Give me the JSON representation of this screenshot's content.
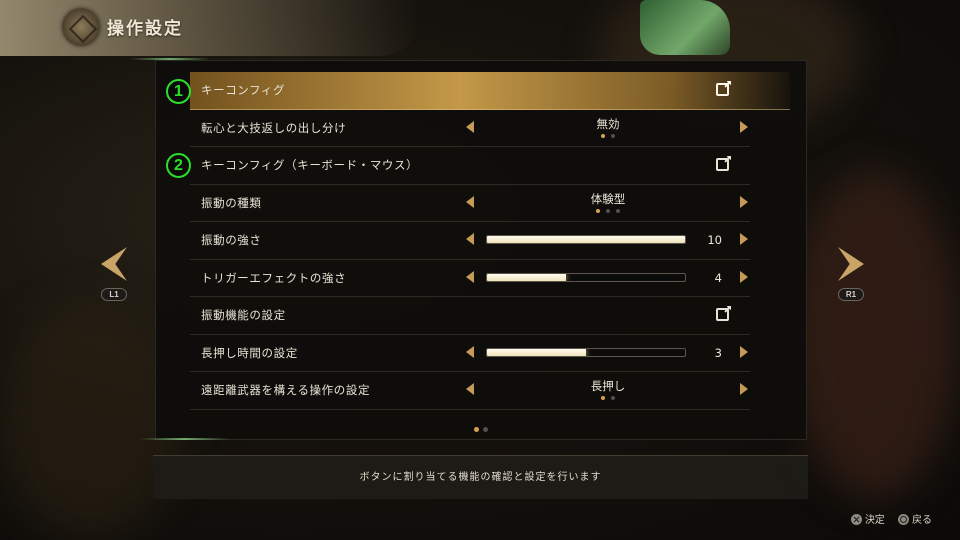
{
  "header": {
    "title": "操作設定"
  },
  "annotations": {
    "badge_1": "1",
    "badge_2": "2"
  },
  "settings": [
    {
      "label": "キーコンフィグ",
      "type": "link",
      "icon": "external-link-icon",
      "selected": true
    },
    {
      "label": "転心と大技返しの出し分け",
      "type": "option",
      "value": "無効",
      "option_count": 2,
      "option_index": 1
    },
    {
      "label": "キーコンフィグ（キーボード・マウス）",
      "type": "link",
      "icon": "external-link-icon"
    },
    {
      "label": "振動の種類",
      "type": "option",
      "value": "体験型",
      "option_count": 3,
      "option_index": 1
    },
    {
      "label": "振動の強さ",
      "type": "slider",
      "value": "10",
      "max": 10
    },
    {
      "label": "トリガーエフェクトの強さ",
      "type": "slider",
      "value": "4",
      "max": 10
    },
    {
      "label": "振動機能の設定",
      "type": "link",
      "icon": "external-link-icon"
    },
    {
      "label": "長押し時間の設定",
      "type": "slider",
      "value": "3",
      "max": 6
    },
    {
      "label": "遠距離武器を構える操作の設定",
      "type": "option",
      "value": "長押し",
      "option_count": 2,
      "option_index": 1
    }
  ],
  "pagination": {
    "pages": 2,
    "current": 1
  },
  "navigation": {
    "left_button": "L1",
    "right_button": "R1"
  },
  "help_text": "ボタンに割り当てる機能の確認と設定を行います",
  "footer": {
    "confirm_label": "決定",
    "back_label": "戻る",
    "confirm_icon": "cross-icon",
    "back_icon": "circle-icon"
  },
  "colors": {
    "accent_gold": "#c79b57",
    "badge_green": "#2be02b",
    "selected_row": "#cda04b"
  }
}
